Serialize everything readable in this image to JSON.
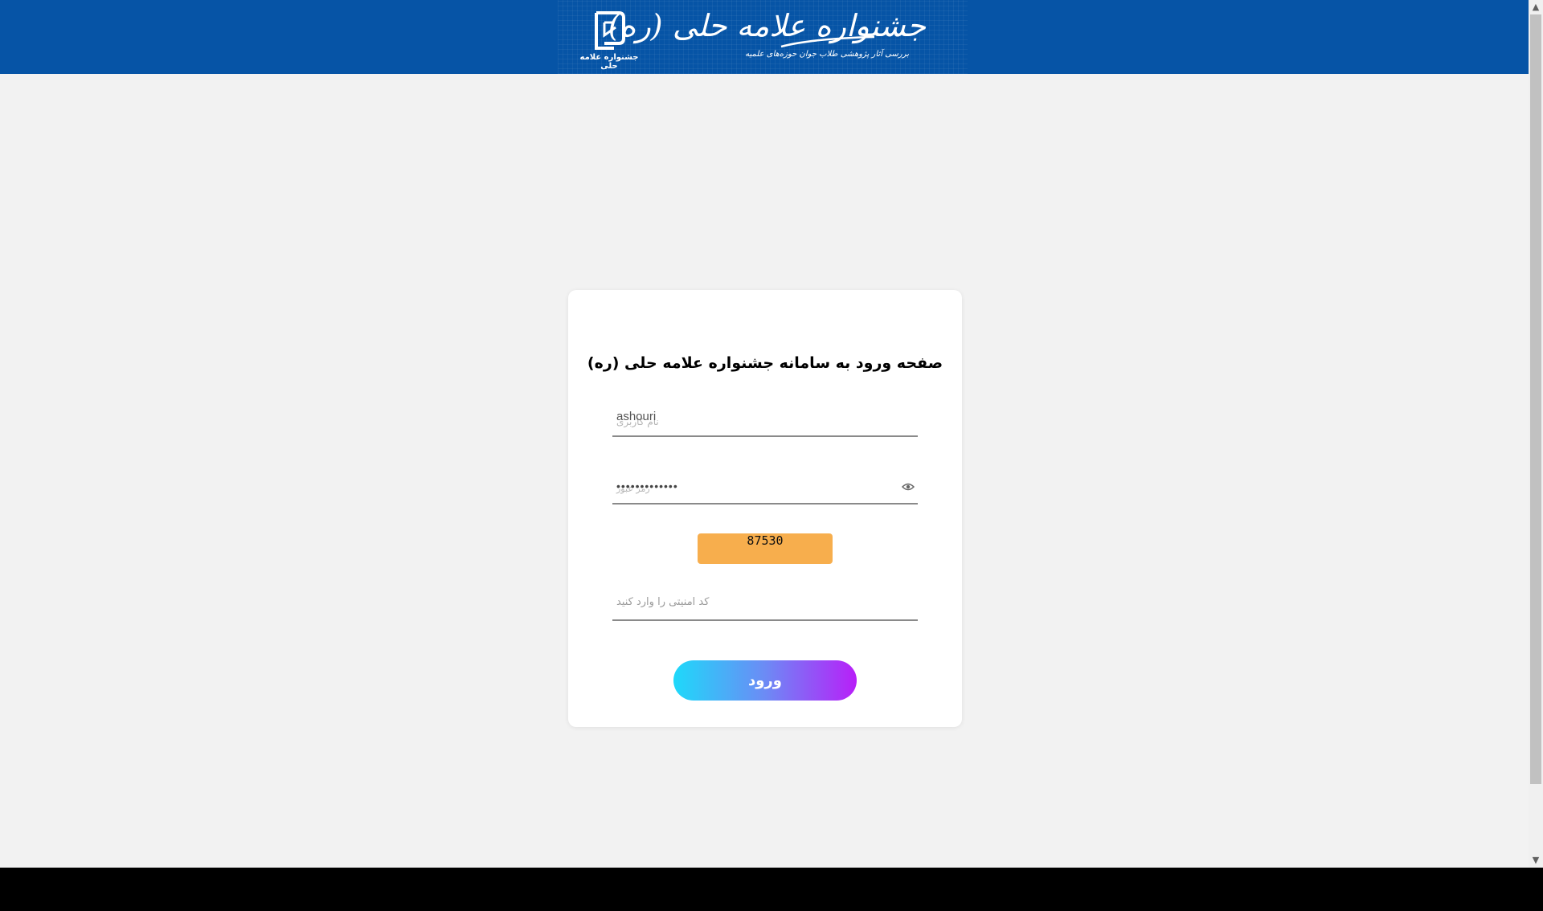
{
  "header": {
    "logo_caption": "جشنواره علامه حلی",
    "brand_title": "جشنواره علامه حلی (ره)",
    "brand_subtitle": "بررسی آثار پژوهشی طلاب جوان حوزه‌های علمیه",
    "background_color": "#0654a6"
  },
  "login": {
    "title": "صفحه ورود به سامانه جشنواره علامه حلی (ره)",
    "username_value": "ashouri",
    "username_placeholder": "نام کاربری",
    "password_value": "•••••••••••••",
    "password_placeholder": "رمز عبور",
    "captcha_code": "87530",
    "captcha_placeholder": "کد امنیتی را وارد کنید",
    "submit_label": "ورود",
    "captcha_color": "#f7ae4d",
    "button_gradient": [
      "#1ed9fa",
      "#b81ff8"
    ]
  },
  "icons": {
    "eye": "eye-icon",
    "scroll_up": "chevron-up-icon",
    "scroll_down": "chevron-down-icon"
  }
}
